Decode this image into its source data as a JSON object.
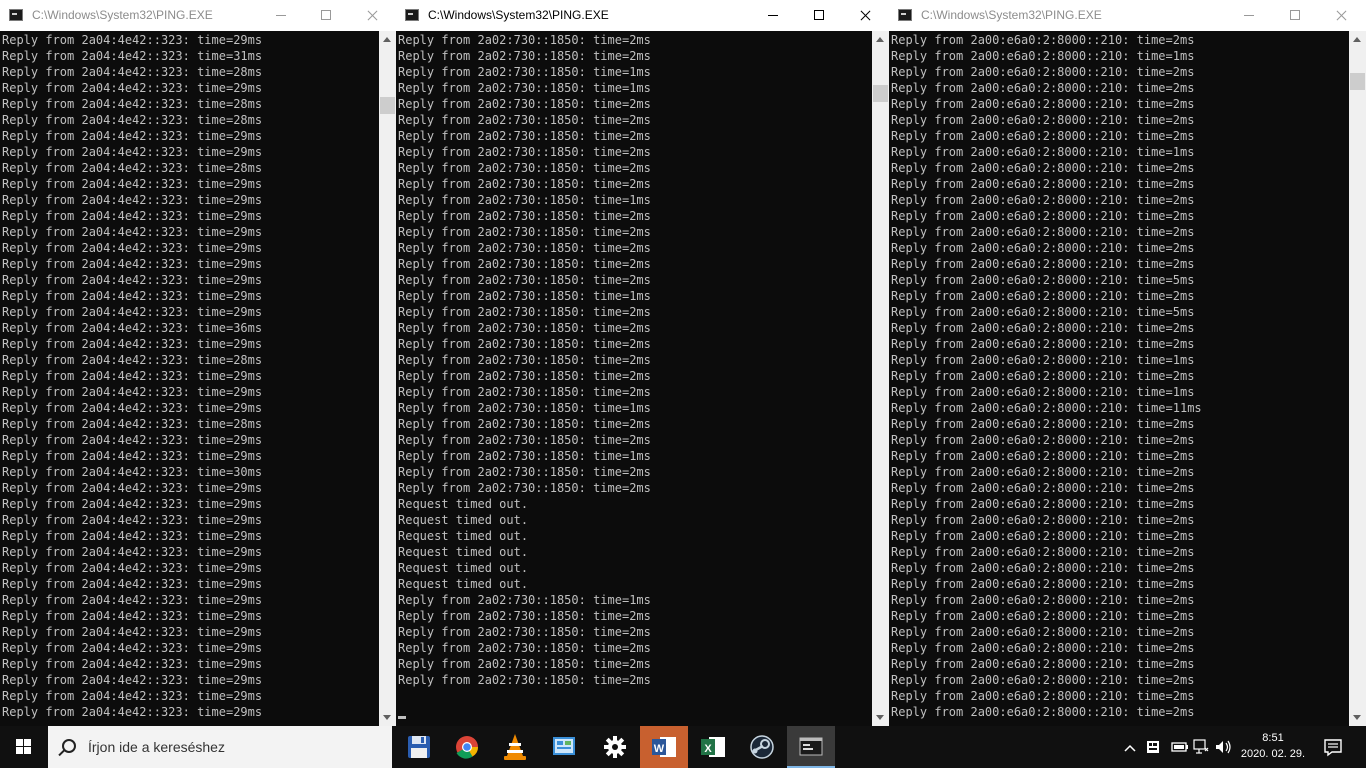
{
  "windows": [
    {
      "title": "C:\\Windows\\System32\\PING.EXE",
      "active": false,
      "lines": [
        "Reply from 2a04:4e42::323: time=29ms",
        "Reply from 2a04:4e42::323: time=31ms",
        "Reply from 2a04:4e42::323: time=28ms",
        "Reply from 2a04:4e42::323: time=29ms",
        "Reply from 2a04:4e42::323: time=28ms",
        "Reply from 2a04:4e42::323: time=28ms",
        "Reply from 2a04:4e42::323: time=29ms",
        "Reply from 2a04:4e42::323: time=29ms",
        "Reply from 2a04:4e42::323: time=28ms",
        "Reply from 2a04:4e42::323: time=29ms",
        "Reply from 2a04:4e42::323: time=29ms",
        "Reply from 2a04:4e42::323: time=29ms",
        "Reply from 2a04:4e42::323: time=29ms",
        "Reply from 2a04:4e42::323: time=29ms",
        "Reply from 2a04:4e42::323: time=29ms",
        "Reply from 2a04:4e42::323: time=29ms",
        "Reply from 2a04:4e42::323: time=29ms",
        "Reply from 2a04:4e42::323: time=29ms",
        "Reply from 2a04:4e42::323: time=36ms",
        "Reply from 2a04:4e42::323: time=29ms",
        "Reply from 2a04:4e42::323: time=28ms",
        "Reply from 2a04:4e42::323: time=29ms",
        "Reply from 2a04:4e42::323: time=29ms",
        "Reply from 2a04:4e42::323: time=29ms",
        "Reply from 2a04:4e42::323: time=28ms",
        "Reply from 2a04:4e42::323: time=29ms",
        "Reply from 2a04:4e42::323: time=29ms",
        "Reply from 2a04:4e42::323: time=30ms",
        "Reply from 2a04:4e42::323: time=29ms",
        "Reply from 2a04:4e42::323: time=29ms",
        "Reply from 2a04:4e42::323: time=29ms",
        "Reply from 2a04:4e42::323: time=29ms",
        "Reply from 2a04:4e42::323: time=29ms",
        "Reply from 2a04:4e42::323: time=29ms",
        "Reply from 2a04:4e42::323: time=29ms",
        "Reply from 2a04:4e42::323: time=29ms",
        "Reply from 2a04:4e42::323: time=29ms",
        "Reply from 2a04:4e42::323: time=29ms",
        "Reply from 2a04:4e42::323: time=29ms",
        "Reply from 2a04:4e42::323: time=29ms",
        "Reply from 2a04:4e42::323: time=29ms",
        "Reply from 2a04:4e42::323: time=29ms",
        "Reply from 2a04:4e42::323: time=29ms"
      ]
    },
    {
      "title": "C:\\Windows\\System32\\PING.EXE",
      "active": true,
      "lines": [
        "Reply from 2a02:730::1850: time=2ms",
        "Reply from 2a02:730::1850: time=2ms",
        "Reply from 2a02:730::1850: time=1ms",
        "Reply from 2a02:730::1850: time=1ms",
        "Reply from 2a02:730::1850: time=2ms",
        "Reply from 2a02:730::1850: time=2ms",
        "Reply from 2a02:730::1850: time=2ms",
        "Reply from 2a02:730::1850: time=2ms",
        "Reply from 2a02:730::1850: time=2ms",
        "Reply from 2a02:730::1850: time=2ms",
        "Reply from 2a02:730::1850: time=1ms",
        "Reply from 2a02:730::1850: time=2ms",
        "Reply from 2a02:730::1850: time=2ms",
        "Reply from 2a02:730::1850: time=2ms",
        "Reply from 2a02:730::1850: time=2ms",
        "Reply from 2a02:730::1850: time=2ms",
        "Reply from 2a02:730::1850: time=1ms",
        "Reply from 2a02:730::1850: time=2ms",
        "Reply from 2a02:730::1850: time=2ms",
        "Reply from 2a02:730::1850: time=2ms",
        "Reply from 2a02:730::1850: time=2ms",
        "Reply from 2a02:730::1850: time=2ms",
        "Reply from 2a02:730::1850: time=2ms",
        "Reply from 2a02:730::1850: time=1ms",
        "Reply from 2a02:730::1850: time=2ms",
        "Reply from 2a02:730::1850: time=2ms",
        "Reply from 2a02:730::1850: time=1ms",
        "Reply from 2a02:730::1850: time=2ms",
        "Reply from 2a02:730::1850: time=2ms",
        "Request timed out.",
        "Request timed out.",
        "Request timed out.",
        "Request timed out.",
        "Request timed out.",
        "Request timed out.",
        "Reply from 2a02:730::1850: time=1ms",
        "Reply from 2a02:730::1850: time=2ms",
        "Reply from 2a02:730::1850: time=2ms",
        "Reply from 2a02:730::1850: time=2ms",
        "Reply from 2a02:730::1850: time=2ms",
        "Reply from 2a02:730::1850: time=2ms"
      ]
    },
    {
      "title": "C:\\Windows\\System32\\PING.EXE",
      "active": false,
      "lines": [
        "Reply from 2a00:e6a0:2:8000::210: time=2ms",
        "Reply from 2a00:e6a0:2:8000::210: time=1ms",
        "Reply from 2a00:e6a0:2:8000::210: time=2ms",
        "Reply from 2a00:e6a0:2:8000::210: time=2ms",
        "Reply from 2a00:e6a0:2:8000::210: time=2ms",
        "Reply from 2a00:e6a0:2:8000::210: time=2ms",
        "Reply from 2a00:e6a0:2:8000::210: time=2ms",
        "Reply from 2a00:e6a0:2:8000::210: time=1ms",
        "Reply from 2a00:e6a0:2:8000::210: time=2ms",
        "Reply from 2a00:e6a0:2:8000::210: time=2ms",
        "Reply from 2a00:e6a0:2:8000::210: time=2ms",
        "Reply from 2a00:e6a0:2:8000::210: time=2ms",
        "Reply from 2a00:e6a0:2:8000::210: time=2ms",
        "Reply from 2a00:e6a0:2:8000::210: time=2ms",
        "Reply from 2a00:e6a0:2:8000::210: time=2ms",
        "Reply from 2a00:e6a0:2:8000::210: time=5ms",
        "Reply from 2a00:e6a0:2:8000::210: time=2ms",
        "Reply from 2a00:e6a0:2:8000::210: time=5ms",
        "Reply from 2a00:e6a0:2:8000::210: time=2ms",
        "Reply from 2a00:e6a0:2:8000::210: time=2ms",
        "Reply from 2a00:e6a0:2:8000::210: time=1ms",
        "Reply from 2a00:e6a0:2:8000::210: time=2ms",
        "Reply from 2a00:e6a0:2:8000::210: time=1ms",
        "Reply from 2a00:e6a0:2:8000::210: time=11ms",
        "Reply from 2a00:e6a0:2:8000::210: time=2ms",
        "Reply from 2a00:e6a0:2:8000::210: time=2ms",
        "Reply from 2a00:e6a0:2:8000::210: time=2ms",
        "Reply from 2a00:e6a0:2:8000::210: time=2ms",
        "Reply from 2a00:e6a0:2:8000::210: time=2ms",
        "Reply from 2a00:e6a0:2:8000::210: time=2ms",
        "Reply from 2a00:e6a0:2:8000::210: time=2ms",
        "Reply from 2a00:e6a0:2:8000::210: time=2ms",
        "Reply from 2a00:e6a0:2:8000::210: time=2ms",
        "Reply from 2a00:e6a0:2:8000::210: time=2ms",
        "Reply from 2a00:e6a0:2:8000::210: time=2ms",
        "Reply from 2a00:e6a0:2:8000::210: time=2ms",
        "Reply from 2a00:e6a0:2:8000::210: time=2ms",
        "Reply from 2a00:e6a0:2:8000::210: time=2ms",
        "Reply from 2a00:e6a0:2:8000::210: time=2ms",
        "Reply from 2a00:e6a0:2:8000::210: time=2ms",
        "Reply from 2a00:e6a0:2:8000::210: time=2ms",
        "Reply from 2a00:e6a0:2:8000::210: time=2ms",
        "Reply from 2a00:e6a0:2:8000::210: time=2ms"
      ]
    }
  ],
  "taskbar": {
    "search_placeholder": "Írjon ide a kereséshez",
    "apps": [
      {
        "icon": "floppy-disk-icon",
        "running": false
      },
      {
        "icon": "chrome-icon",
        "running": false
      },
      {
        "icon": "vlc-icon",
        "running": false
      },
      {
        "icon": "control-panel-icon",
        "running": false
      },
      {
        "icon": "settings-gear-icon",
        "running": false
      },
      {
        "icon": "word-icon",
        "running": false
      },
      {
        "icon": "excel-icon",
        "running": false
      },
      {
        "icon": "steam-icon",
        "running": false
      },
      {
        "icon": "console-icon",
        "running": true
      }
    ],
    "clock_time": "8:51",
    "clock_date": "2020. 02. 29.",
    "accent_color": "#7fb6e6"
  }
}
